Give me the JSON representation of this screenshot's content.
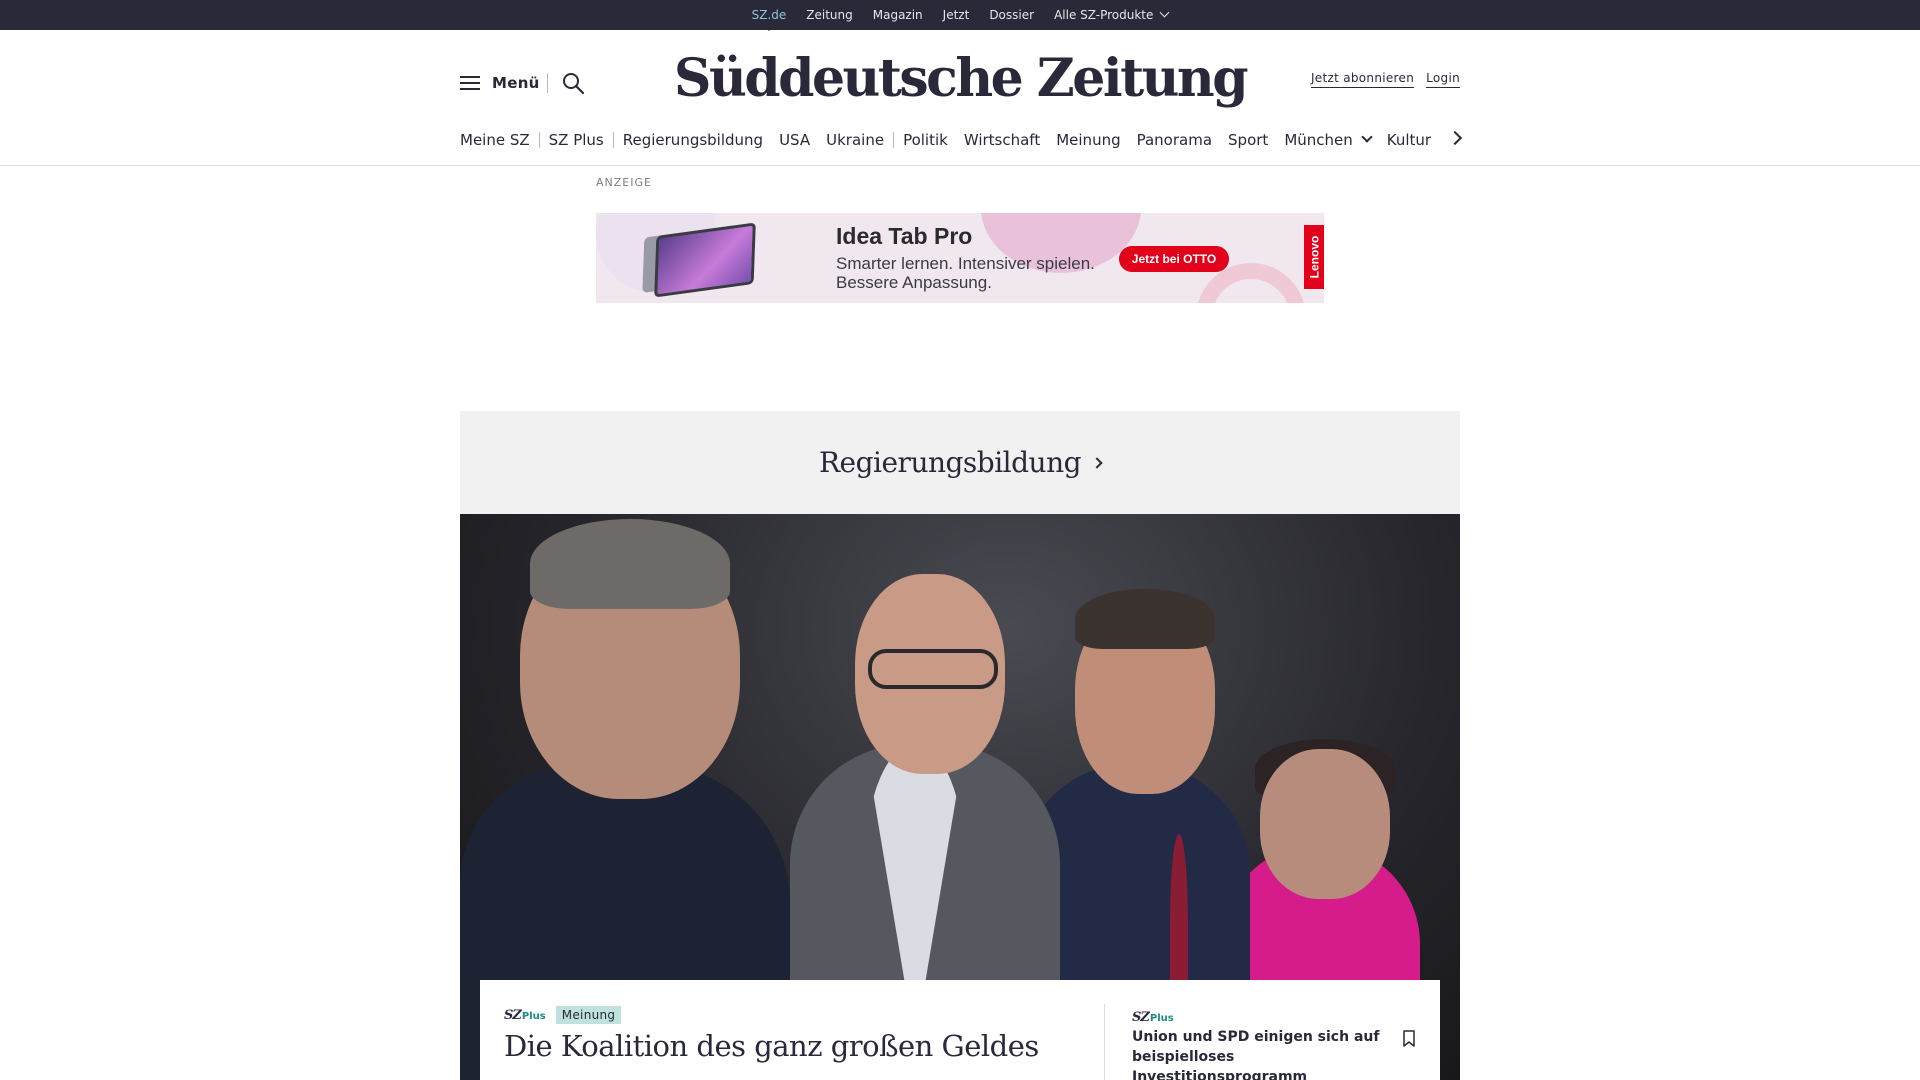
{
  "topbar": {
    "links": [
      {
        "label": "SZ.de",
        "active": true
      },
      {
        "label": "Zeitung"
      },
      {
        "label": "Magazin"
      },
      {
        "label": "Jetzt"
      },
      {
        "label": "Dossier"
      },
      {
        "label": "Alle SZ-Produkte",
        "dropdown": true
      }
    ]
  },
  "header": {
    "menu_label": "Menü",
    "search_icon": "search-icon",
    "logo_text": "Süddeutsche Zeitung",
    "subscribe_label": "Jetzt abonnieren",
    "login_label": "Login"
  },
  "nav": {
    "items": [
      "Meine SZ",
      "SZ Plus",
      "Regierungsbildung",
      "USA",
      "Ukraine",
      "Politik",
      "Wirtschaft",
      "Meinung",
      "Panorama",
      "Sport",
      "München",
      "Kultur"
    ]
  },
  "ad": {
    "label": "ANZEIGE",
    "title": "Idea Tab Pro",
    "subtitle": "Smarter lernen. Intensiver spielen. Bessere Anpassung.",
    "cta": "Jetzt bei OTTO",
    "brand": "Lenovo"
  },
  "section": {
    "title": "Regierungsbildung"
  },
  "lead_article": {
    "plus_sz": "SZ",
    "plus_word": "Plus",
    "tag": "Meinung",
    "title": "Die Koalition des ganz großen Geldes"
  },
  "side_article": {
    "plus_sz": "SZ",
    "plus_word": "Plus",
    "title": "Union und SPD einigen sich auf beispielloses Investitionsprogramm"
  },
  "colors": {
    "dark": "#29293a",
    "accent_teal": "#1b8a84",
    "tag_bg": "#bfe2dd",
    "section_bg": "#f1f1f2",
    "ad_red": "#e2001a"
  }
}
